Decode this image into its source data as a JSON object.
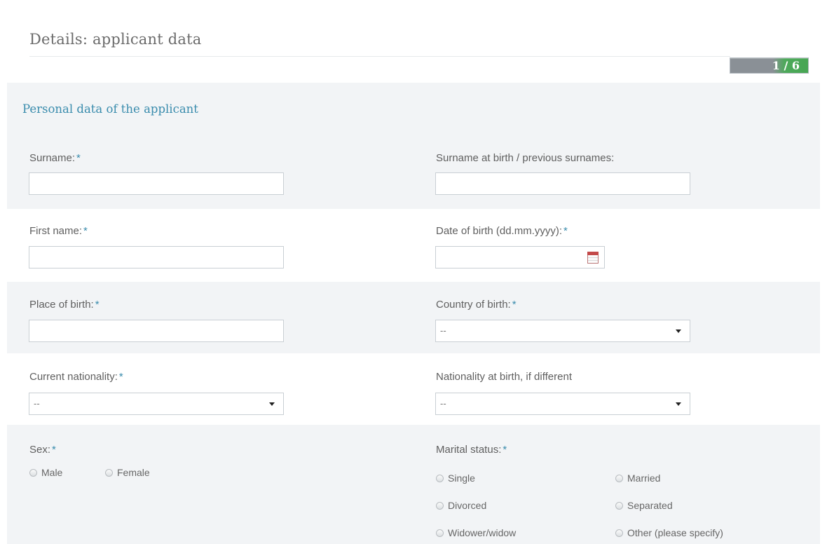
{
  "header": {
    "title": "Details: applicant data",
    "step": "1 / 6"
  },
  "section": {
    "title": "Personal data of the applicant"
  },
  "fields": {
    "surname": {
      "label": "Surname:",
      "required": "*",
      "value": ""
    },
    "previous_surnames": {
      "label": "Surname at birth / previous surnames:",
      "value": ""
    },
    "first_name": {
      "label": "First name:",
      "required": "*",
      "value": ""
    },
    "date_of_birth": {
      "label": "Date of birth (dd.mm.yyyy):",
      "required": "*",
      "value": "",
      "icon": "calendar-icon"
    },
    "place_of_birth": {
      "label": "Place of birth:",
      "required": "*",
      "value": ""
    },
    "country_of_birth": {
      "label": "Country of birth:",
      "required": "*",
      "selected": "--"
    },
    "current_nationality": {
      "label": "Current nationality:",
      "required": "*",
      "selected": "--"
    },
    "nationality_at_birth": {
      "label": "Nationality at birth, if different",
      "selected": "--"
    }
  },
  "sex": {
    "label": "Sex:",
    "required": "*",
    "options": [
      "Male",
      "Female"
    ]
  },
  "marital_status": {
    "label": "Marital status:",
    "required": "*",
    "options": [
      "Single",
      "Married",
      "Divorced",
      "Separated",
      "Widower/widow",
      "Other (please specify)"
    ]
  },
  "colors": {
    "accent": "#3a8cad",
    "progress_green": "#47a653",
    "progress_gray": "#8a9096"
  }
}
